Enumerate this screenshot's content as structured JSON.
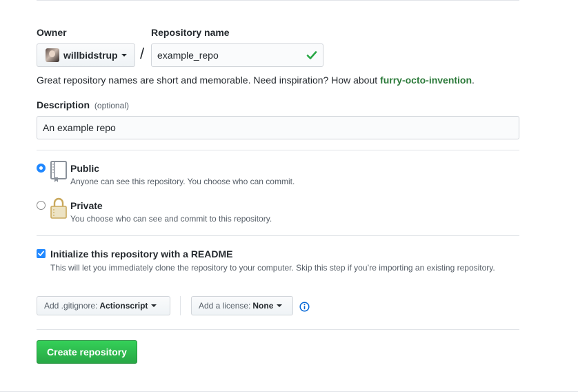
{
  "form": {
    "owner_label": "Owner",
    "owner_value": "willbidstrup",
    "separator": "/",
    "repo_label": "Repository name",
    "repo_value": "example_repo",
    "hint_text": "Great repository names are short and memorable. Need inspiration? How about ",
    "suggestion": "furry-octo-invention",
    "hint_end": ".",
    "description_label": "Description",
    "description_optional": "(optional)",
    "description_value": "An example repo"
  },
  "visibility": {
    "public_title": "Public",
    "public_note": "Anyone can see this repository. You choose who can commit.",
    "private_title": "Private",
    "private_note": "You choose who can see and commit to this repository.",
    "selected": "public"
  },
  "readme": {
    "title": "Initialize this repository with a README",
    "note": "This will let you immediately clone the repository to your computer. Skip this step if you’re importing an existing repository.",
    "checked": true
  },
  "options": {
    "gitignore_prefix": "Add .gitignore:",
    "gitignore_value": "Actionscript",
    "license_prefix": "Add a license:",
    "license_value": "None"
  },
  "actions": {
    "create_label": "Create repository"
  },
  "colors": {
    "accent_blue": "#2188ff",
    "success_green": "#28a745",
    "create_button": "#2cbe4e"
  },
  "icons": [
    "check-icon",
    "repo-book-icon",
    "lock-icon",
    "info-icon",
    "caret-down-icon"
  ]
}
